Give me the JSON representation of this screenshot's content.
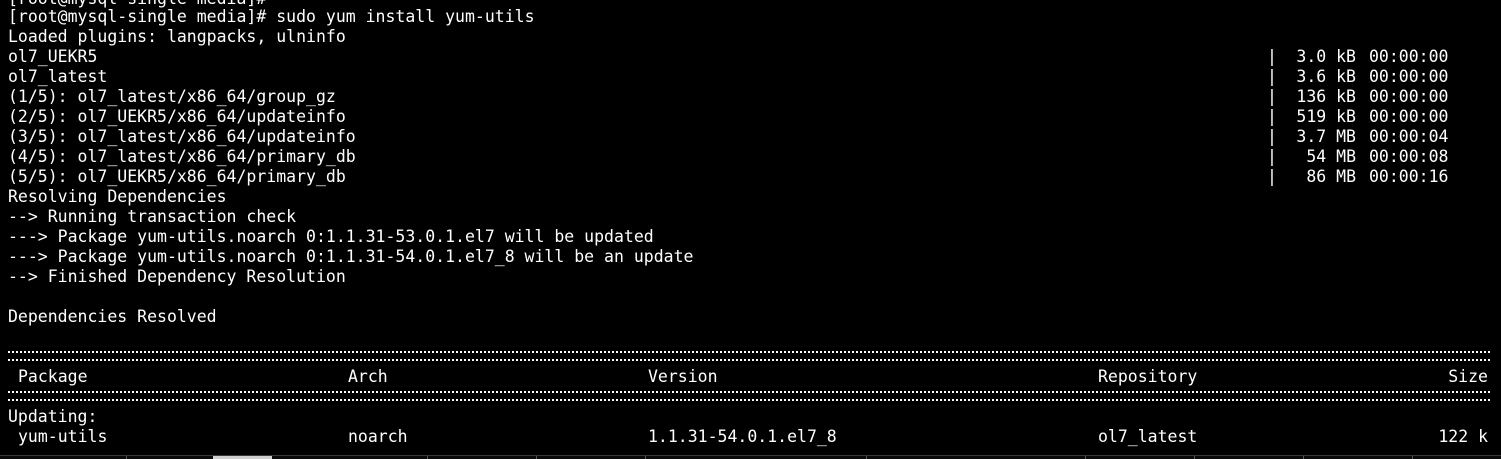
{
  "terminal": {
    "cut_off_line": "[root@mysql-single media]#",
    "prompt": "[root@mysql-single media]#",
    "command": "sudo yum install yum-utils",
    "loaded_plugins": "Loaded plugins: langpacks, ulninfo",
    "downloads": [
      {
        "name": "ol7_UEKR5",
        "size": "3.0 kB",
        "time": "00:00:00"
      },
      {
        "name": "ol7_latest",
        "size": "3.6 kB",
        "time": "00:00:00"
      },
      {
        "name": "(1/5): ol7_latest/x86_64/group_gz",
        "size": "136 kB",
        "time": "00:00:00"
      },
      {
        "name": "(2/5): ol7_UEKR5/x86_64/updateinfo",
        "size": "519 kB",
        "time": "00:00:00"
      },
      {
        "name": "(3/5): ol7_latest/x86_64/updateinfo",
        "size": "3.7 MB",
        "time": "00:00:04"
      },
      {
        "name": "(4/5): ol7_latest/x86_64/primary_db",
        "size": "54 MB",
        "time": "00:00:08"
      },
      {
        "name": "(5/5): ol7_UEKR5/x86_64/primary_db",
        "size": "86 MB",
        "time": "00:00:16"
      }
    ],
    "pipe": "|",
    "resolving": "Resolving Dependencies",
    "running_check": "--> Running transaction check",
    "pkg_updated": "---> Package yum-utils.noarch 0:1.1.31-53.0.1.el7 will be updated",
    "pkg_update": "---> Package yum-utils.noarch 0:1.1.31-54.0.1.el7_8 will be an update",
    "finished": "--> Finished Dependency Resolution",
    "deps_resolved": "Dependencies Resolved",
    "table": {
      "headers": {
        "package": "Package",
        "arch": "Arch",
        "version": "Version",
        "repository": "Repository",
        "size": "Size"
      },
      "section": "Updating:",
      "rows": [
        {
          "package": "yum-utils",
          "arch": "noarch",
          "version": "1.1.31-54.0.1.el7_8",
          "repository": "ol7_latest",
          "size": "122 k"
        }
      ]
    }
  },
  "colors": {
    "background": "#000000",
    "foreground": "#ffffff"
  }
}
